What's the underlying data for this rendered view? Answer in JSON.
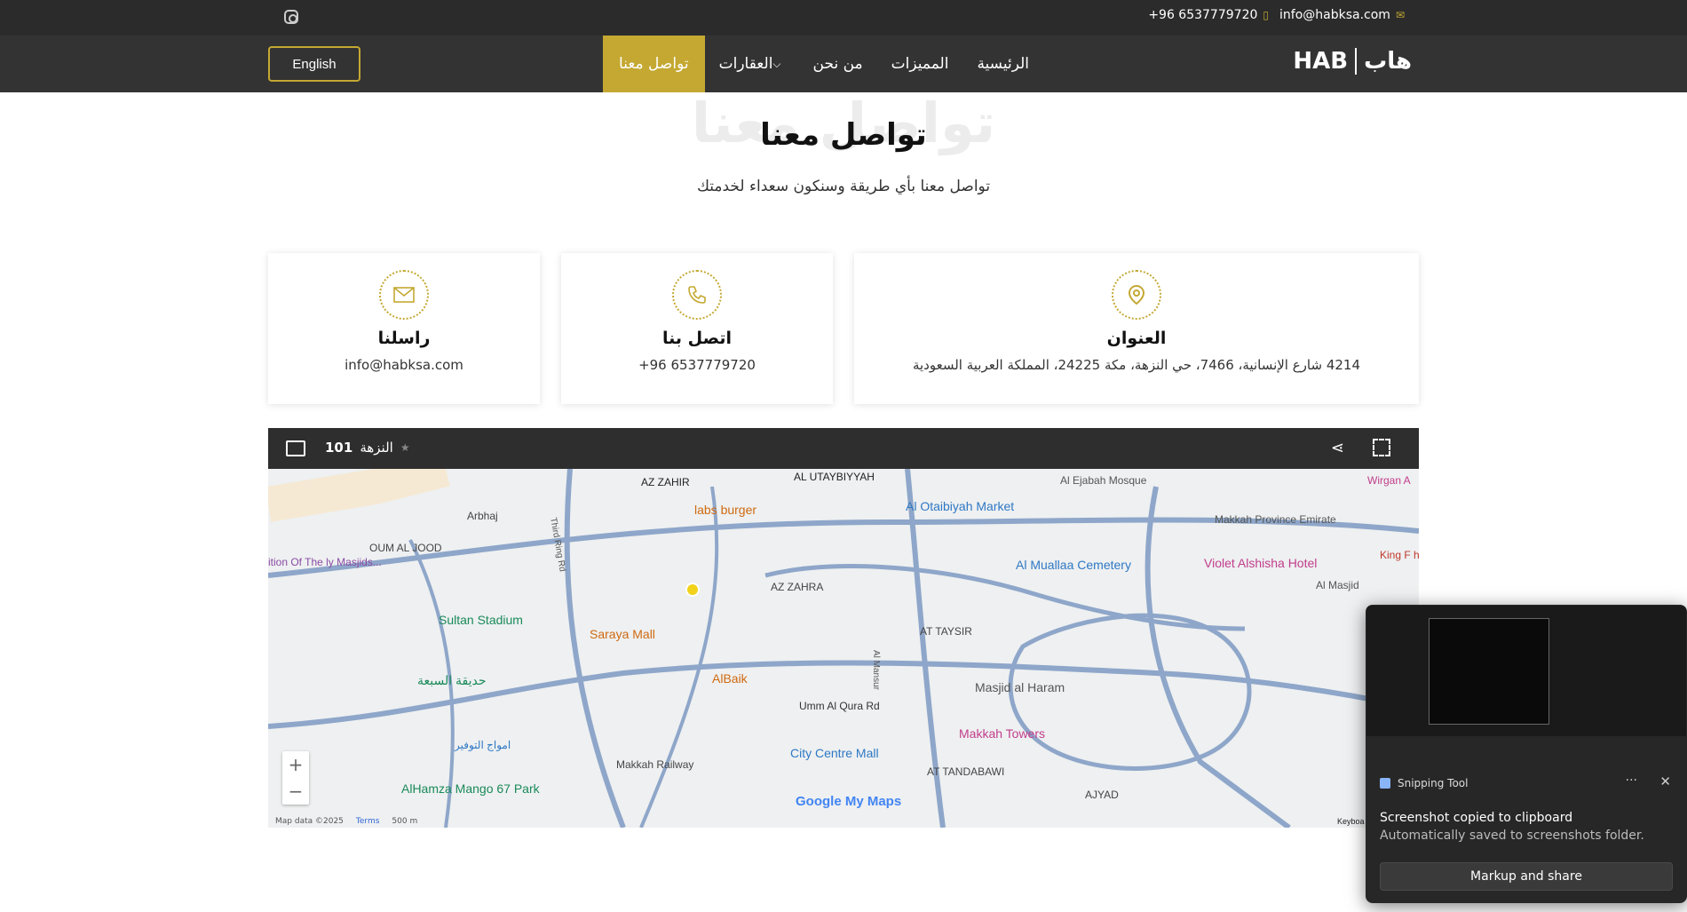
{
  "topbar": {
    "phone": "+96 6537779720",
    "email": "info@habksa.com",
    "instagram_icon": "instagram-icon"
  },
  "nav": {
    "logo_en": "HAB",
    "logo_ar": "هاب",
    "items": [
      {
        "label": "الرئيسية"
      },
      {
        "label": "المميزات"
      },
      {
        "label": "من نحن"
      },
      {
        "label": "العقارات"
      },
      {
        "label": "تواصل معنا"
      }
    ],
    "active_index": 4,
    "lang_button": "English",
    "accent": "#c4a832"
  },
  "header": {
    "ghost": "تواصل معنا",
    "title": "تواصل معنا",
    "subtitle": "تواصل معنا بأي طريقة وسنكون سعداء لخدمتك"
  },
  "cards": {
    "address": {
      "title": "العنوان",
      "value": "4214 شارع الإنسانية، 7466، حي النزهة، مكة 24225، المملكة العربية السعودية",
      "icon": "map-pin-icon"
    },
    "phone": {
      "title": "اتصل بنا",
      "value": "+96 6537779720",
      "icon": "phone-icon"
    },
    "email": {
      "title": "راسلنا",
      "value": "info@habksa.com",
      "icon": "envelope-icon"
    }
  },
  "map": {
    "place_number": "101",
    "place_name": "النزهة",
    "labels": [
      "AZ ZAHIR",
      "AL UTAYBIYYAH",
      "Al Ejabah Mosque",
      "Wirgan A",
      "labs burger",
      "Al Otaibiyah Market",
      "Arbhaj",
      "Makkah Province Emirate",
      "OUM AL JOOD",
      "Violet Alshisha Hotel",
      "King F hospit",
      "Al Muallaa Cemetery",
      "ition Of The ly Masjids...",
      "AZ ZAHRA",
      "Sultan Stadium",
      "Saraya Mall",
      "AT TAYSIR",
      "حديقة السبعة",
      "AlBaik",
      "Masjid al Haram",
      "Umm Al Qura Rd",
      "Makkah Towers",
      "امواج التوفير",
      "City Centre Mall",
      "Makkah Railway",
      "AT TANDABAWI",
      "AlHamza Mango 67 Park",
      "AJYAD",
      "Al Masjid",
      "Third Ring Rd",
      "Al Mansur"
    ],
    "google": "Google My Maps",
    "attribution": [
      "Map data ©2025",
      "Terms",
      "500 m"
    ],
    "keyboard": "Keyboa"
  },
  "toast": {
    "app": "Snipping Tool",
    "title": "Screenshot copied to clipboard",
    "body": "Automatically saved to screenshots folder.",
    "button": "Markup and share"
  }
}
